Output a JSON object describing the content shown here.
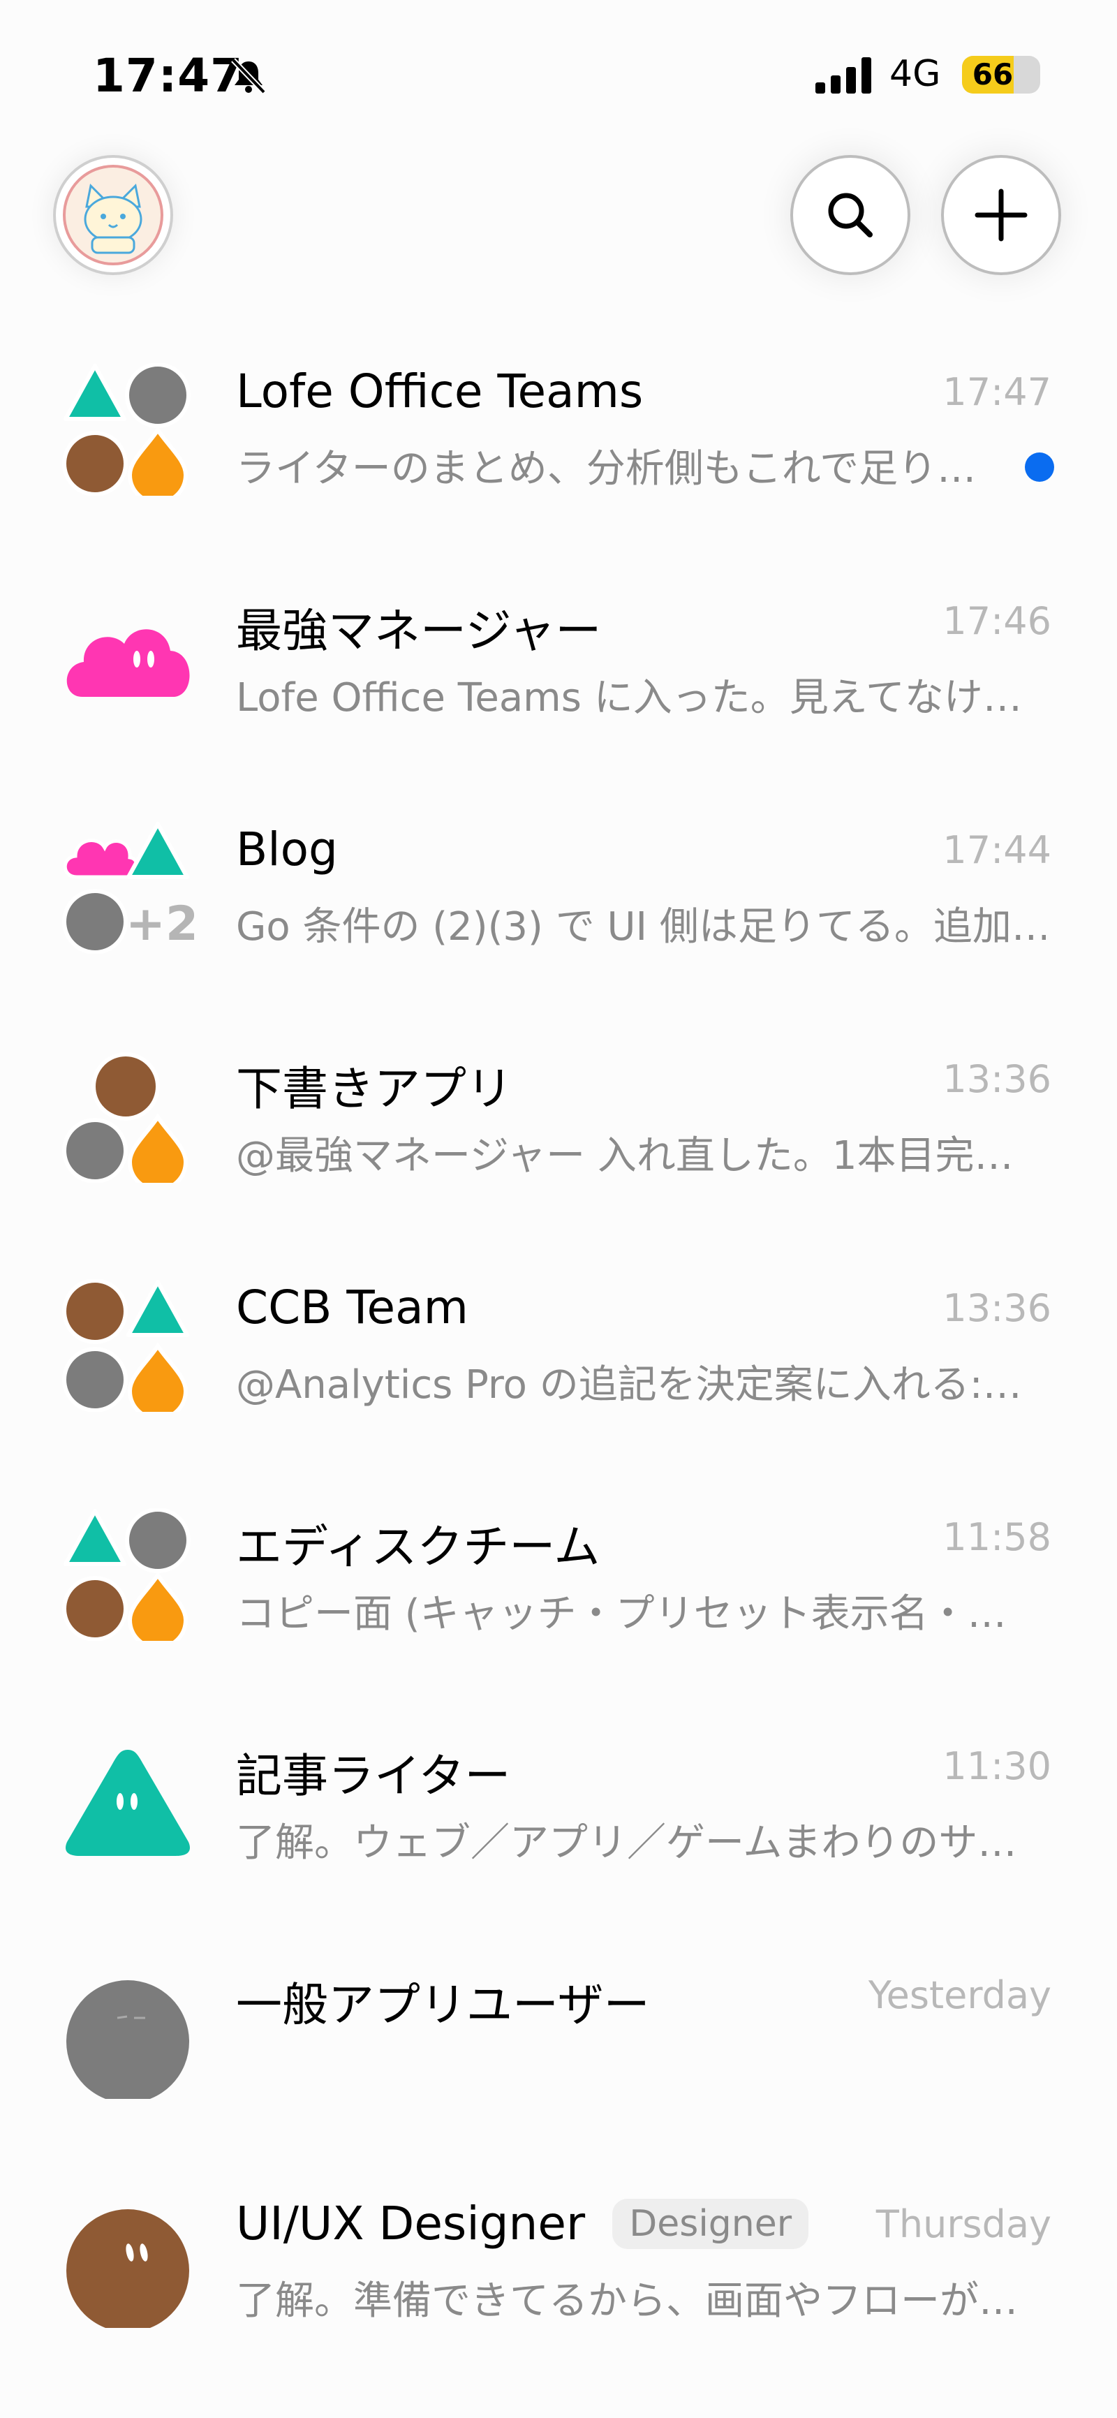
{
  "status_bar": {
    "time": "17:47",
    "network": "4G",
    "battery": "66",
    "battery_fraction": 0.66
  },
  "header": {
    "avatar_icon": "cat-avatar-icon",
    "search_icon": "search-icon",
    "new_icon": "plus-icon"
  },
  "chats": [
    {
      "name": "Lofe Office Teams",
      "time": "17:47",
      "preview": "ライターのまとめ、分析側もこれで足り…",
      "unread": true,
      "avatar": "group-4"
    },
    {
      "name": "最強マネージャー",
      "time": "17:46",
      "preview": "Lofe Office Teams に入った。見えてなけ…",
      "avatar": "pink-cloud"
    },
    {
      "name": "Blog",
      "time": "17:44",
      "preview": "Go 条件の (2)(3) で UI 側は足りてる。追加…",
      "avatar": "group-plus2",
      "extra_count": "+2"
    },
    {
      "name": "下書きアプリ",
      "time": "13:36",
      "preview": "@最強マネージャー 入れ直した。1本目完…",
      "avatar": "group-3"
    },
    {
      "name": "CCB Team",
      "time": "13:36",
      "preview": "@Analytics Pro の追記を決定案に入れる:…",
      "avatar": "group-4b"
    },
    {
      "name": "エディスクチーム",
      "time": "11:58",
      "preview": "コピー面 (キャッチ・プリセット表示名・…",
      "avatar": "group-4"
    },
    {
      "name": "記事ライター",
      "time": "11:30",
      "preview": "了解。ウェブ／アプリ／ゲームまわりのサ…",
      "avatar": "teal-triangle"
    },
    {
      "name": "一般アプリユーザー",
      "time": "Yesterday",
      "preview": "",
      "avatar": "gray-circle"
    },
    {
      "name": "UI/UX Designer",
      "tag": "Designer",
      "time": "Thursday",
      "preview": "了解。準備できてるから、画面やフローが…",
      "avatar": "brown-circle"
    }
  ],
  "colors": {
    "teal": "#10bfa6",
    "gray": "#7c7c7c",
    "brown": "#8f5a34",
    "orange": "#f99a10",
    "pink": "#ff36b2",
    "unread": "#0a6cf0",
    "battery": "#f5cc1b"
  }
}
